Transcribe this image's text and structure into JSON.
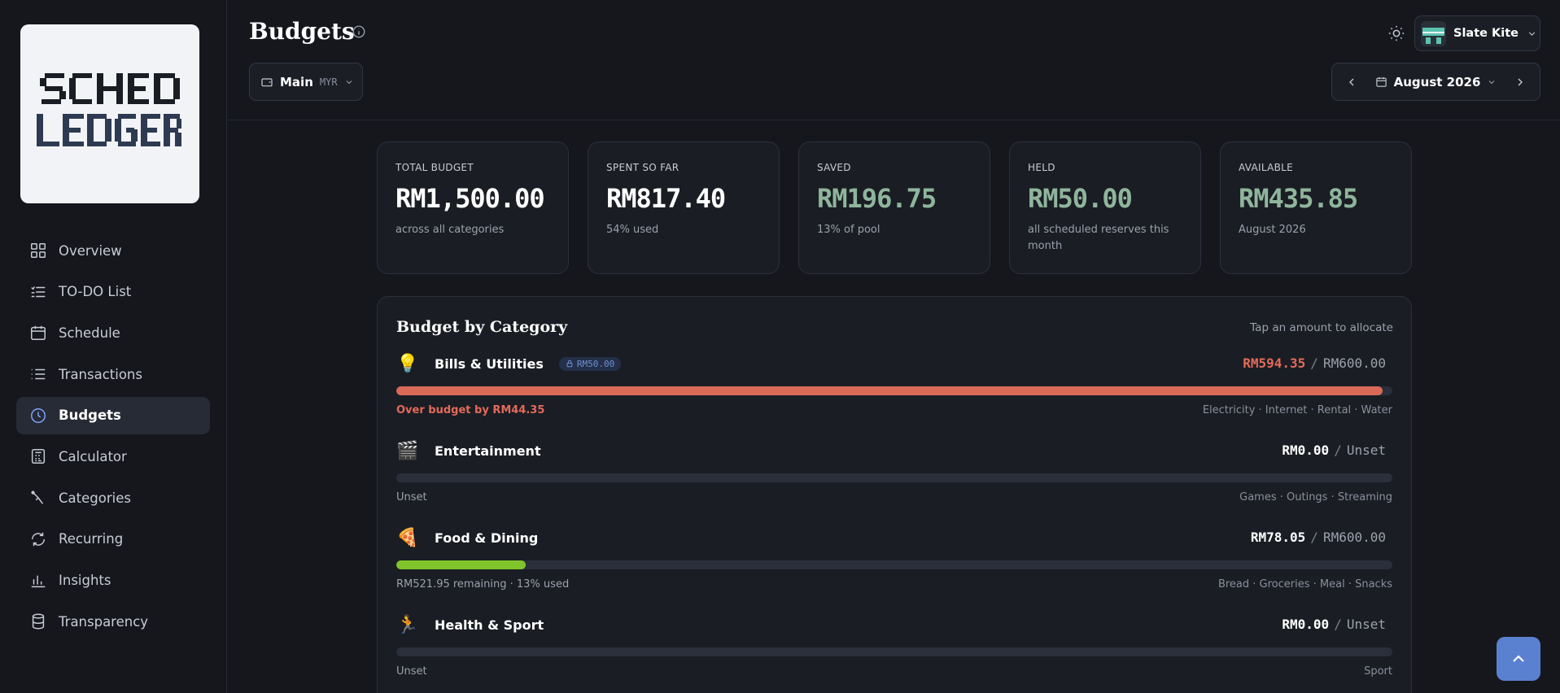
{
  "app": {
    "logo_alt": "SCHED LEDGER"
  },
  "sidebar": {
    "items": [
      {
        "label": "Overview",
        "icon": "grid-icon"
      },
      {
        "label": "TO-DO List",
        "icon": "list-check-icon"
      },
      {
        "label": "Schedule",
        "icon": "calendar-icon"
      },
      {
        "label": "Transactions",
        "icon": "list-icon"
      },
      {
        "label": "Budgets",
        "icon": "clock-icon",
        "active": true
      },
      {
        "label": "Calculator",
        "icon": "calculator-icon"
      },
      {
        "label": "Categories",
        "icon": "tag-icon"
      },
      {
        "label": "Recurring",
        "icon": "refresh-icon"
      },
      {
        "label": "Insights",
        "icon": "bar-chart-icon"
      },
      {
        "label": "Transparency",
        "icon": "database-icon"
      }
    ]
  },
  "header": {
    "title": "Budgets",
    "wallet": {
      "name": "Main",
      "currency": "MYR"
    },
    "user": {
      "name": "Slate Kite"
    },
    "month": "August 2026"
  },
  "stats": [
    {
      "label": "TOTAL BUDGET",
      "value": "RM1,500.00",
      "sub": "across all categories",
      "tone": "white"
    },
    {
      "label": "SPENT SO FAR",
      "value": "RM817.40",
      "sub": "54% used",
      "tone": "white"
    },
    {
      "label": "SAVED",
      "value": "RM196.75",
      "sub": "13% of pool",
      "tone": "green"
    },
    {
      "label": "HELD",
      "value": "RM50.00",
      "sub": "all scheduled reserves this month",
      "tone": "green"
    },
    {
      "label": "AVAILABLE",
      "value": "RM435.85",
      "sub": "August 2026",
      "tone": "green"
    }
  ],
  "categories_card": {
    "title": "Budget by Category",
    "hint": "Tap an amount to allocate",
    "rows": [
      {
        "emoji": "💡",
        "name": "Bills & Utilities",
        "hold": "RM50.00",
        "spent": "RM594.35",
        "limit": "RM600.00",
        "over": true,
        "progress": 0.99,
        "bar_color": "#d96a58",
        "status": "Over budget by RM44.35",
        "tags": "Electricity · Internet · Rental · Water"
      },
      {
        "emoji": "🎬",
        "name": "Entertainment",
        "hold": "",
        "spent": "RM0.00",
        "limit": "Unset",
        "over": false,
        "progress": 0,
        "bar_color": "#2a2f3b",
        "status": "Unset",
        "tags": "Games · Outings · Streaming"
      },
      {
        "emoji": "🍕",
        "name": "Food & Dining",
        "hold": "",
        "spent": "RM78.05",
        "limit": "RM600.00",
        "over": false,
        "progress": 0.13,
        "bar_color": "#7fc42a",
        "status": "RM521.95 remaining · 13% used",
        "tags": "Bread · Groceries · Meal · Snacks"
      },
      {
        "emoji": "🏃",
        "name": "Health & Sport",
        "hold": "",
        "spent": "RM0.00",
        "limit": "Unset",
        "over": false,
        "progress": 0,
        "bar_color": "#2a2f3b",
        "status": "Unset",
        "tags": "Sport"
      }
    ]
  }
}
